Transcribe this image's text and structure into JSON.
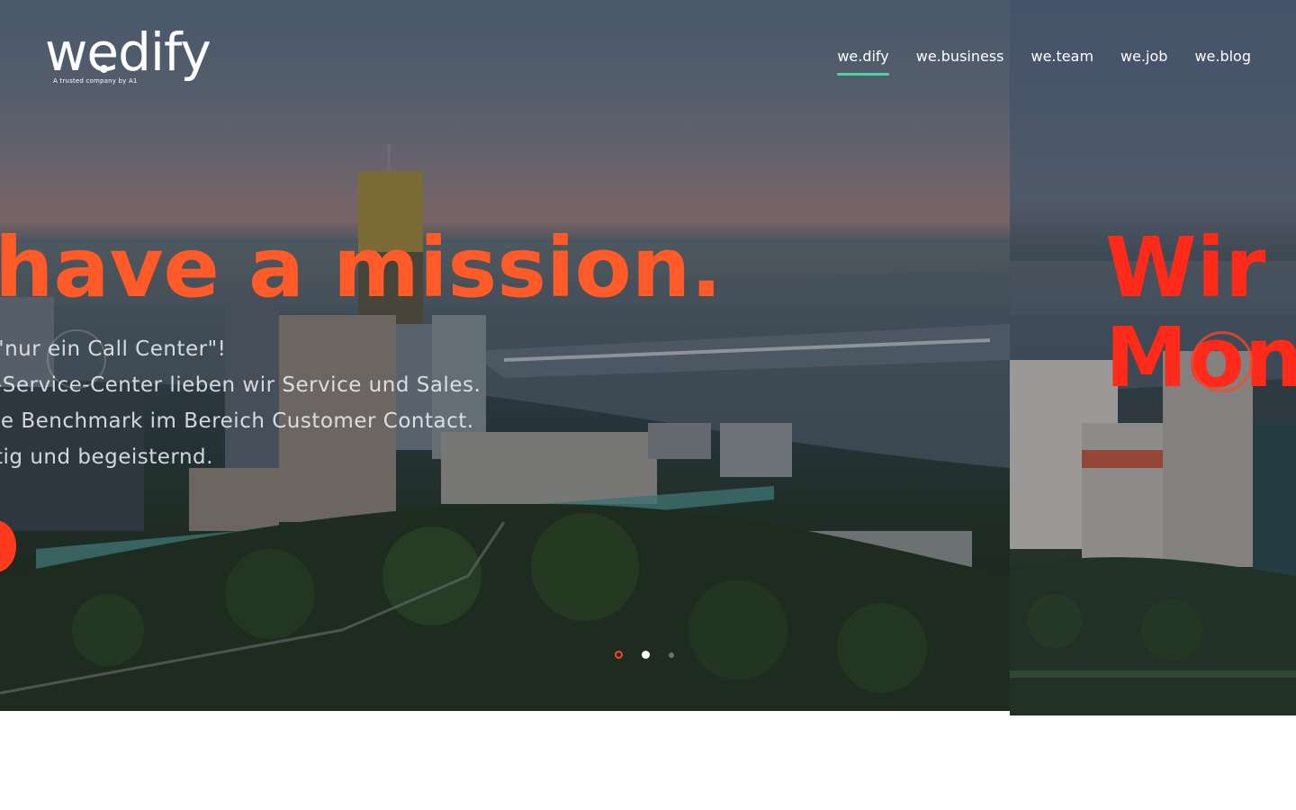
{
  "header": {
    "logo": {
      "wordmark": "wedify",
      "tagline": "A trusted company by A1"
    },
    "nav": [
      {
        "label": "we.dify",
        "active": true
      },
      {
        "label": "we.business",
        "active": false
      },
      {
        "label": "we.team",
        "active": false
      },
      {
        "label": "we.job",
        "active": false
      },
      {
        "label": "we.blog",
        "active": false
      }
    ]
  },
  "slides": [
    {
      "headline": "have a mission.",
      "lines": [
        "\"nur ein Call Center\"!",
        "-Service-Center lieben wir Service und Sales.",
        "le Benchmark im Bereich Customer Contact.",
        "tig und begeisternd."
      ]
    },
    {
      "headline_lines": [
        "Wir",
        "Mon"
      ]
    }
  ],
  "pagination": {
    "count": 3,
    "active_index": 1
  },
  "colors": {
    "accent_orange": "#ff5a28",
    "accent_red": "#ff2a1a",
    "nav_underline": "#4fd1a5"
  }
}
